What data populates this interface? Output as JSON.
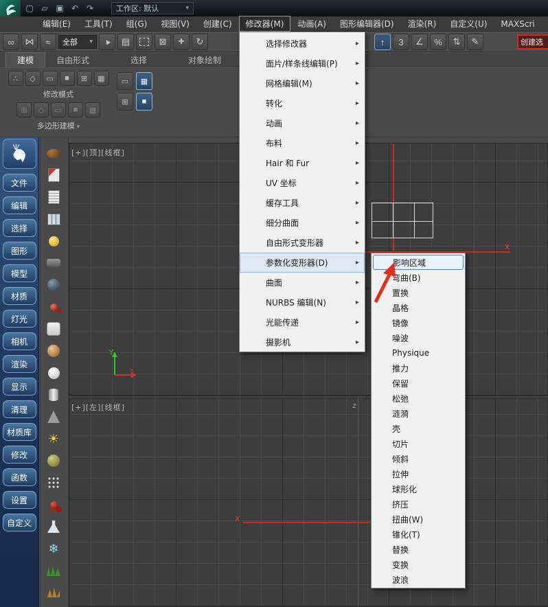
{
  "title_bar": {
    "workspace_label": "工作区: 默认",
    "icons": [
      "app-logo-icon",
      "new-file-icon",
      "open-file-icon",
      "save-icon",
      "undo-icon",
      "redo-icon"
    ]
  },
  "menu_bar": {
    "items": [
      "编辑(E)",
      "工具(T)",
      "组(G)",
      "视图(V)",
      "创建(C)",
      "修改器(M)",
      "动画(A)",
      "图形编辑器(D)",
      "渲染(R)",
      "自定义(U)",
      "MAXScri"
    ],
    "active_item": "修改器(M)"
  },
  "toolbar": {
    "icons": [
      "link-icon",
      "unlink-icon",
      "bind-space-warp-icon",
      "selection-filter-combo",
      "select-object-icon",
      "select-by-name-icon",
      "rectangular-region-icon",
      "window-crossing-icon",
      "move-icon",
      "rotate-icon",
      "snap-toggle-icon",
      "angle-snap-icon",
      "percent-snap-icon",
      "spinner-snap-icon",
      "edit-keys-icon"
    ],
    "selection_filter_value": "全部",
    "snap_mode_label": "3",
    "percent_snap_label": "%",
    "create_selection_label": "创建选"
  },
  "ribbon": {
    "tabs": [
      "建模",
      "自由形式",
      "选择",
      "对象绘制"
    ],
    "active_tab": "建模",
    "modify_mode_label": "修改模式",
    "poly_modeling_label": "多边形建模"
  },
  "sidebar": {
    "items": [
      "文件",
      "编辑",
      "选择",
      "图形",
      "模型",
      "材质",
      "灯光",
      "相机",
      "渲染",
      "显示",
      "清理",
      "材质库",
      "修改",
      "函数",
      "设置",
      "自定义"
    ],
    "logo": "deer-logo-icon"
  },
  "tool_column": {
    "icons": [
      "teapot-icon",
      "material-editor-icon",
      "notes-icon",
      "spreadsheet-icon",
      "lightbulb-icon",
      "camera-icon",
      "sphere-icon",
      "spheres-red-icon",
      "plane-icon",
      "sphere-bronze-icon",
      "circle-icon",
      "cylinder-icon",
      "cone-icon",
      "sun-icon",
      "sphere-olive-icon",
      "scatter-icon",
      "berries-icon",
      "flask-icon",
      "snowflake-icon",
      "grass-icon",
      "wheat-icon"
    ]
  },
  "viewports": {
    "top_label": "[+][顶][线框]",
    "left_label": "[+][左][线框]",
    "axis_x_top": "x",
    "gizmo_y": "Y",
    "gizmo_x": "x",
    "axis_z_bottom": "z",
    "axis_x_bottom": "x"
  },
  "modifier_menu": {
    "items": [
      "选择修改器",
      "面片/样条线编辑(P)",
      "网格编辑(M)",
      "转化",
      "动画",
      "布料",
      "Hair 和 Fur",
      "UV 坐标",
      "缓存工具",
      "细分曲面",
      "自由形式变形器",
      "参数化变形器(D)",
      "曲面",
      "NURBS 编辑(N)",
      "光能传递",
      "摄影机"
    ],
    "highlighted_item": "参数化变形器(D)"
  },
  "parametric_submenu": {
    "items": [
      "影响区域",
      "弯曲(B)",
      "置换",
      "晶格",
      "镜像",
      "噪波",
      "Physique",
      "推力",
      "保留",
      "松弛",
      "涟漪",
      "壳",
      "切片",
      "倾斜",
      "拉伸",
      "球形化",
      "挤压",
      "扭曲(W)",
      "锥化(T)",
      "替换",
      "变换",
      "波浪"
    ],
    "highlighted_item": "影响区域"
  },
  "colors": {
    "accent_red": "#cc2a1e",
    "menu_highlight": "#dfe8f3",
    "submenu_highlight_border": "#4e7fb8",
    "viewport_bg": "#3d3d3d",
    "sidebar_blue": "#2a4a75",
    "menu_bg": "#f1f1ef"
  }
}
